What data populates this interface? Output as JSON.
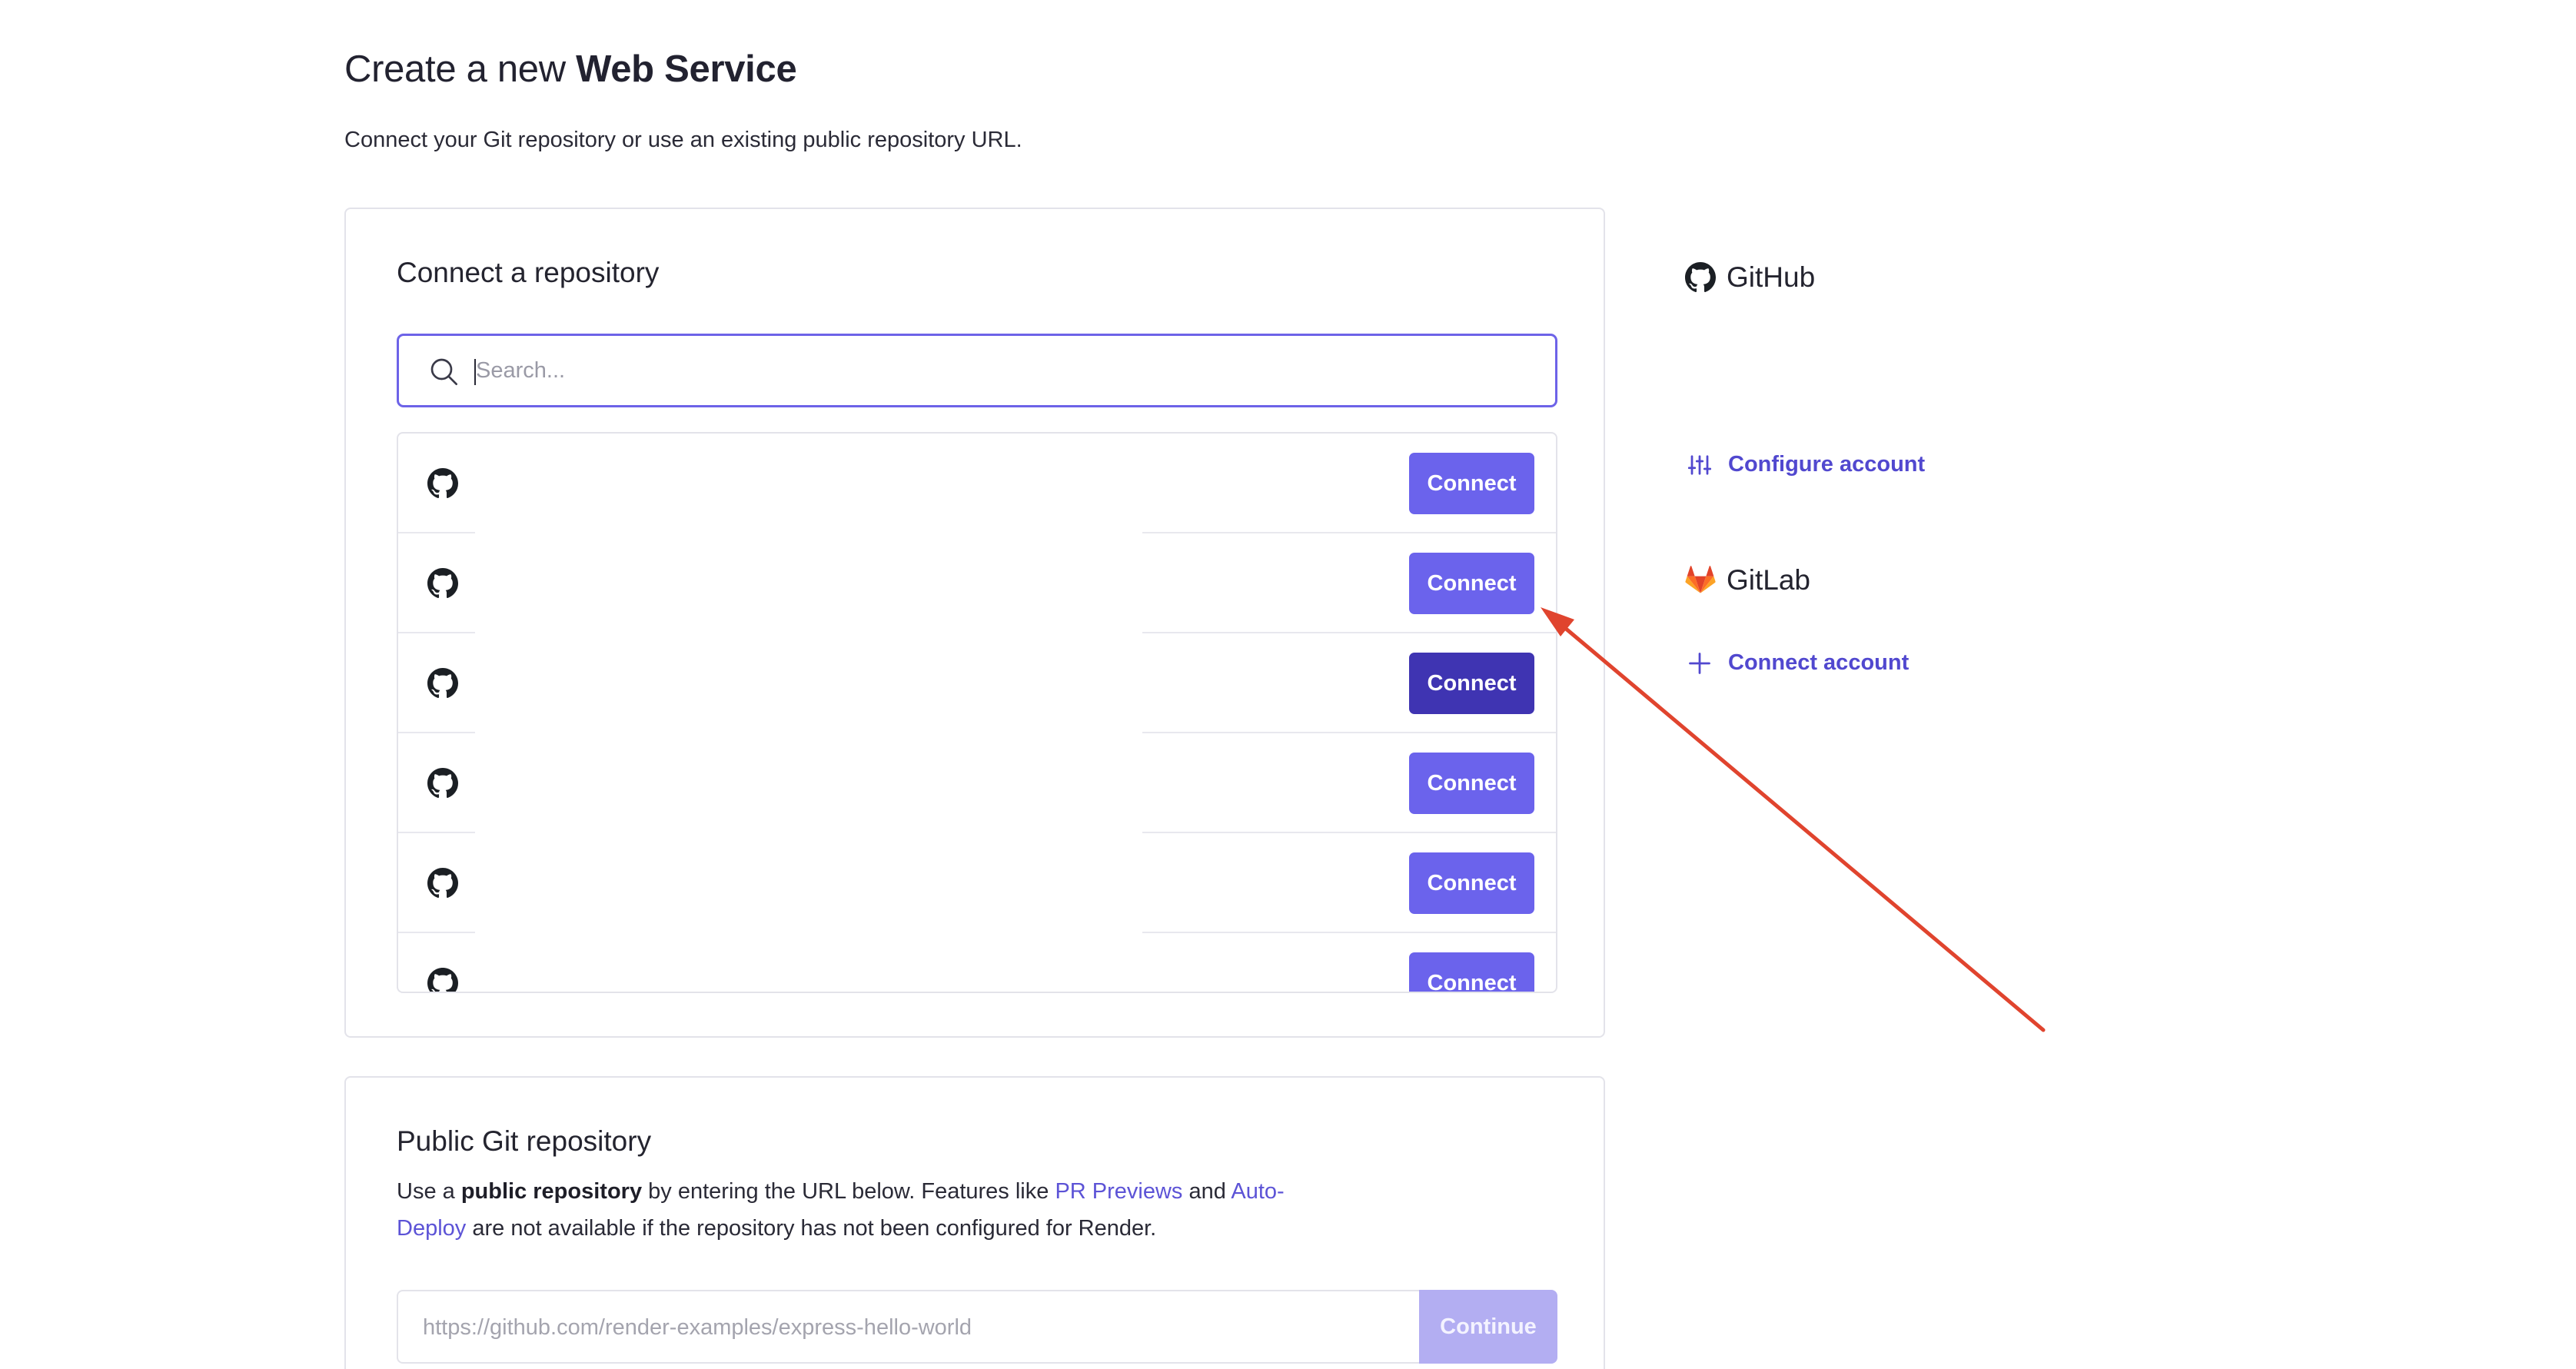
{
  "header": {
    "title_prefix": "Create a new",
    "title_emphasis": "Web Service",
    "subtitle": "Connect your Git repository or use an existing public repository URL."
  },
  "connect_repo": {
    "heading": "Connect a repository",
    "search": {
      "placeholder": "Search...",
      "value": ""
    },
    "repos": [
      {
        "name": "",
        "button_label": "Connect"
      },
      {
        "name": "",
        "button_label": "Connect"
      },
      {
        "name": "",
        "button_label": "Connect"
      },
      {
        "name": "",
        "button_label": "Connect"
      },
      {
        "name": "",
        "button_label": "Connect"
      },
      {
        "name": "",
        "button_label": "Connect"
      }
    ]
  },
  "public_repo": {
    "heading": "Public Git repository",
    "desc_1": "Use a",
    "desc_bold": "public repository",
    "desc_2": "by entering the URL below. Features like",
    "link_pr_previews": "PR Previews",
    "desc_and": "and",
    "link_auto_deploy": "Auto-Deploy",
    "desc_3": "are not available if the repository has not been configured for Render.",
    "url_placeholder": "https://github.com/render-examples/express-hello-world",
    "continue_label": "Continue"
  },
  "sidebar": {
    "github": {
      "label": "GitHub",
      "icon": "github-icon"
    },
    "configure_account": {
      "label": "Configure account",
      "icon": "sliders-icon"
    },
    "gitlab": {
      "label": "GitLab",
      "icon": "gitlab-icon"
    },
    "connect_account": {
      "label": "Connect account",
      "icon": "plus-icon"
    }
  },
  "colors": {
    "accent": "#6b63ec",
    "accent_active": "#3f34b2",
    "link": "#5148cf",
    "annotation_arrow": "#e0442e"
  }
}
